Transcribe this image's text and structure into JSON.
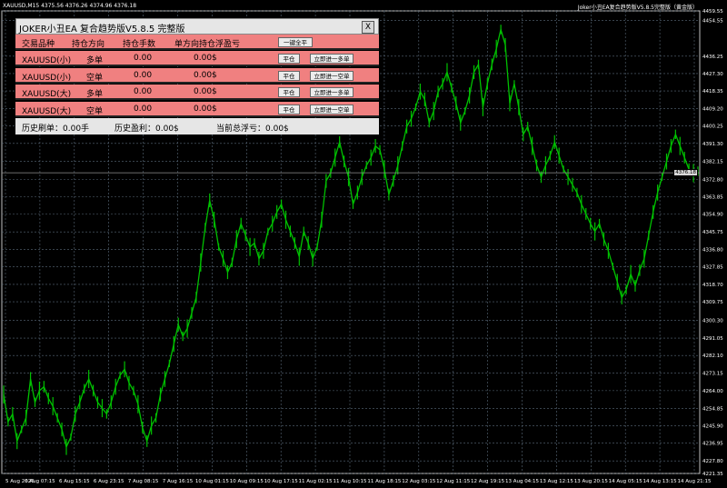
{
  "chart_header": {
    "symbol": "XAUUSD,M15",
    "ohlc": "4375.56 4376.26 4374.96 4376.18",
    "indicator": "Joker小丑EA复合趋势版V5.8.5完整版（黄金版）"
  },
  "panel": {
    "title": "JOKER小丑EA 复合趋势版V5.8.5 完整版",
    "close_label": "X",
    "header": {
      "col_symbol": "交易品种",
      "col_direction": "持仓方向",
      "col_lots": "持仓手数",
      "col_pnl": "单方向持仓浮盈亏",
      "close_all_label": "一键全平"
    },
    "rows": [
      {
        "symbol": "XAUUSD(小)",
        "direction": "多单",
        "lots": "0.00",
        "pnl": "0.00$",
        "close_label": "平仓",
        "open_label": "立即进一多单"
      },
      {
        "symbol": "XAUUSD(小)",
        "direction": "空单",
        "lots": "0.00",
        "pnl": "0.00$",
        "close_label": "平仓",
        "open_label": "立即进一空单"
      },
      {
        "symbol": "XAUUSD(大)",
        "direction": "多单",
        "lots": "0.00",
        "pnl": "0.00$",
        "close_label": "平仓",
        "open_label": "立即进一多单"
      },
      {
        "symbol": "XAUUSD(大)",
        "direction": "空单",
        "lots": "0.00",
        "pnl": "0.00$",
        "close_label": "平仓",
        "open_label": "立即进一空单"
      }
    ],
    "footer": {
      "history_volume": "历史刷单：0.00手",
      "history_profit": "历史盈利：0.00$",
      "current_float": "当前总浮亏：0.00$"
    }
  },
  "current_price_label": "4376.18",
  "colors": {
    "candle": "#00c000",
    "grid": "#5a6a7a",
    "panel_row": "#f08080",
    "background": "#000000"
  },
  "chart_data": {
    "type": "line",
    "series": [
      {
        "values": [
          4262,
          4248,
          4252,
          4238,
          4244,
          4250,
          4270,
          4258,
          4264,
          4266,
          4260,
          4256,
          4250,
          4244,
          4235,
          4240,
          4252,
          4258,
          4265,
          4270,
          4264,
          4258,
          4255,
          4252,
          4258,
          4266,
          4272,
          4275,
          4268,
          4264,
          4257,
          4245,
          4238,
          4246,
          4250,
          4262,
          4270,
          4278,
          4288,
          4298,
          4292,
          4296,
          4304,
          4312,
          4330,
          4348,
          4362,
          4352,
          4338,
          4332,
          4325,
          4330,
          4342,
          4350,
          4344,
          4338,
          4340,
          4332,
          4336,
          4346,
          4350,
          4356,
          4360,
          4352,
          4346,
          4340,
          4333,
          4346,
          4340,
          4332,
          4338,
          4352,
          4372,
          4376,
          4384,
          4392,
          4382,
          4374,
          4360,
          4366,
          4374,
          4380,
          4384,
          4390,
          4388,
          4378,
          4365,
          4372,
          4380,
          4390,
          4400,
          4404,
          4410,
          4418,
          4414,
          4402,
          4408,
          4418,
          4422,
          4428,
          4420,
          4412,
          4402,
          4408,
          4416,
          4428,
          4432,
          4410,
          4422,
          4432,
          4440,
          4450,
          4442,
          4412,
          4422,
          4410,
          4396,
          4400,
          4390,
          4380,
          4374,
          4380,
          4385,
          4392,
          4385,
          4378,
          4374,
          4370,
          4366,
          4360,
          4355,
          4350,
          4346,
          4350,
          4342,
          4336,
          4328,
          4320,
          4312,
          4316,
          4324,
          4318,
          4326,
          4332,
          4344,
          4356,
          4366,
          4374,
          4382,
          4390,
          4396,
          4390,
          4384,
          4378,
          4376,
          4377
        ]
      }
    ],
    "ylim": [
      4221.35,
      4459.55
    ],
    "y_ticks": [
      "4459.55",
      "4454.55",
      "4436.25",
      "4427.30",
      "4418.35",
      "4409.20",
      "4400.25",
      "4391.30",
      "4382.15",
      "4372.80",
      "4363.85",
      "4354.90",
      "4345.75",
      "4336.80",
      "4327.85",
      "4318.70",
      "4309.75",
      "4300.30",
      "4291.05",
      "4282.10",
      "4273.15",
      "4264.00",
      "4254.85",
      "4245.90",
      "4236.95",
      "4227.80",
      "4221.35"
    ],
    "x_ticks": [
      "5 Aug 2026",
      "6 Aug 07:15",
      "6 Aug 15:15",
      "6 Aug 23:15",
      "7 Aug 08:15",
      "7 Aug 16:15",
      "10 Aug 01:15",
      "10 Aug 09:15",
      "10 Aug 17:15",
      "11 Aug 02:15",
      "11 Aug 10:15",
      "11 Aug 18:15",
      "12 Aug 03:15",
      "12 Aug 11:15",
      "12 Aug 19:15",
      "13 Aug 04:15",
      "13 Aug 12:15",
      "13 Aug 20:15",
      "14 Aug 05:15",
      "14 Aug 13:15",
      "14 Aug 21:15"
    ],
    "grid": true
  }
}
